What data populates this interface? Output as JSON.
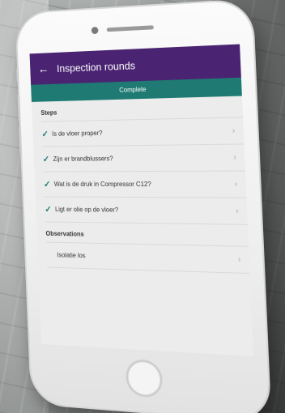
{
  "app": {
    "title": "Inspection rounds",
    "back_icon": "←"
  },
  "complete_button": {
    "label": "Complete",
    "color": "#1f7a73"
  },
  "header_color": "#4a2472",
  "steps": {
    "label": "Steps",
    "items": [
      {
        "label": "Is de vloer proper?",
        "checked": true
      },
      {
        "label": "Zijn er brandblussers?",
        "checked": true
      },
      {
        "label": "Wat is de druk in Compressor C12?",
        "checked": true
      },
      {
        "label": "Ligt er olie op de vloer?",
        "checked": true
      }
    ]
  },
  "observations": {
    "label": "Observations",
    "items": [
      {
        "label": "Isolatie los"
      }
    ]
  },
  "icons": {
    "check": "✓",
    "chevron": "›"
  }
}
